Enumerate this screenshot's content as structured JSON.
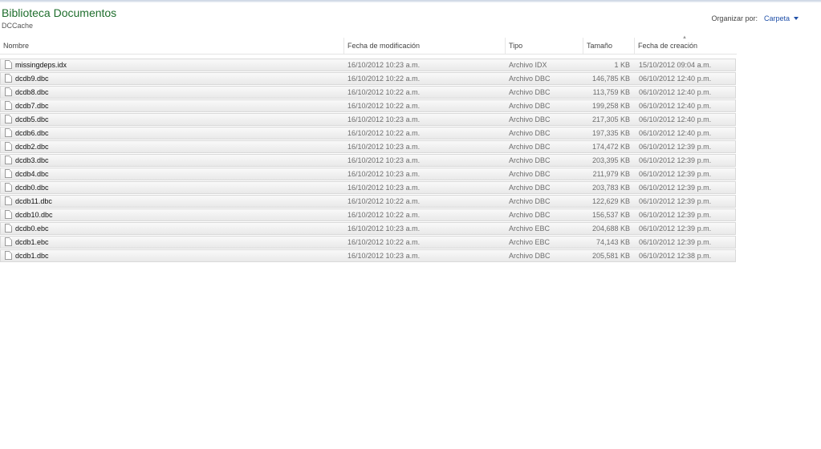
{
  "library": {
    "title": "Biblioteca Documentos",
    "folder": "DCCache"
  },
  "arrange": {
    "label": "Organizar por:",
    "value": "Carpeta"
  },
  "columns": {
    "name": "Nombre",
    "modified": "Fecha de modificación",
    "type": "Tipo",
    "size": "Tamaño",
    "created": "Fecha de creación"
  },
  "files": [
    {
      "name": "missingdeps.idx",
      "modified": "16/10/2012 10:23 a.m.",
      "type": "Archivo IDX",
      "size": "1 KB",
      "created": "15/10/2012 09:04 a.m."
    },
    {
      "name": "dcdb9.dbc",
      "modified": "16/10/2012 10:22 a.m.",
      "type": "Archivo DBC",
      "size": "146,785 KB",
      "created": "06/10/2012 12:40 p.m."
    },
    {
      "name": "dcdb8.dbc",
      "modified": "16/10/2012 10:22 a.m.",
      "type": "Archivo DBC",
      "size": "113,759 KB",
      "created": "06/10/2012 12:40 p.m."
    },
    {
      "name": "dcdb7.dbc",
      "modified": "16/10/2012 10:22 a.m.",
      "type": "Archivo DBC",
      "size": "199,258 KB",
      "created": "06/10/2012 12:40 p.m."
    },
    {
      "name": "dcdb5.dbc",
      "modified": "16/10/2012 10:23 a.m.",
      "type": "Archivo DBC",
      "size": "217,305 KB",
      "created": "06/10/2012 12:40 p.m."
    },
    {
      "name": "dcdb6.dbc",
      "modified": "16/10/2012 10:22 a.m.",
      "type": "Archivo DBC",
      "size": "197,335 KB",
      "created": "06/10/2012 12:40 p.m."
    },
    {
      "name": "dcdb2.dbc",
      "modified": "16/10/2012 10:23 a.m.",
      "type": "Archivo DBC",
      "size": "174,472 KB",
      "created": "06/10/2012 12:39 p.m."
    },
    {
      "name": "dcdb3.dbc",
      "modified": "16/10/2012 10:23 a.m.",
      "type": "Archivo DBC",
      "size": "203,395 KB",
      "created": "06/10/2012 12:39 p.m."
    },
    {
      "name": "dcdb4.dbc",
      "modified": "16/10/2012 10:23 a.m.",
      "type": "Archivo DBC",
      "size": "211,979 KB",
      "created": "06/10/2012 12:39 p.m."
    },
    {
      "name": "dcdb0.dbc",
      "modified": "16/10/2012 10:23 a.m.",
      "type": "Archivo DBC",
      "size": "203,783 KB",
      "created": "06/10/2012 12:39 p.m."
    },
    {
      "name": "dcdb11.dbc",
      "modified": "16/10/2012 10:22 a.m.",
      "type": "Archivo DBC",
      "size": "122,629 KB",
      "created": "06/10/2012 12:39 p.m."
    },
    {
      "name": "dcdb10.dbc",
      "modified": "16/10/2012 10:22 a.m.",
      "type": "Archivo DBC",
      "size": "156,537 KB",
      "created": "06/10/2012 12:39 p.m."
    },
    {
      "name": "dcdb0.ebc",
      "modified": "16/10/2012 10:23 a.m.",
      "type": "Archivo EBC",
      "size": "204,688 KB",
      "created": "06/10/2012 12:39 p.m."
    },
    {
      "name": "dcdb1.ebc",
      "modified": "16/10/2012 10:22 a.m.",
      "type": "Archivo EBC",
      "size": "74,143 KB",
      "created": "06/10/2012 12:39 p.m."
    },
    {
      "name": "dcdb1.dbc",
      "modified": "16/10/2012 10:23 a.m.",
      "type": "Archivo DBC",
      "size": "205,581 KB",
      "created": "06/10/2012 12:38 p.m."
    }
  ],
  "icons": {
    "file": "file-icon",
    "dropdown": "chevron-down-icon",
    "sort": "sort-indicator-icon"
  },
  "colors": {
    "title": "#1e6e2c",
    "link": "#1f4fa8"
  }
}
